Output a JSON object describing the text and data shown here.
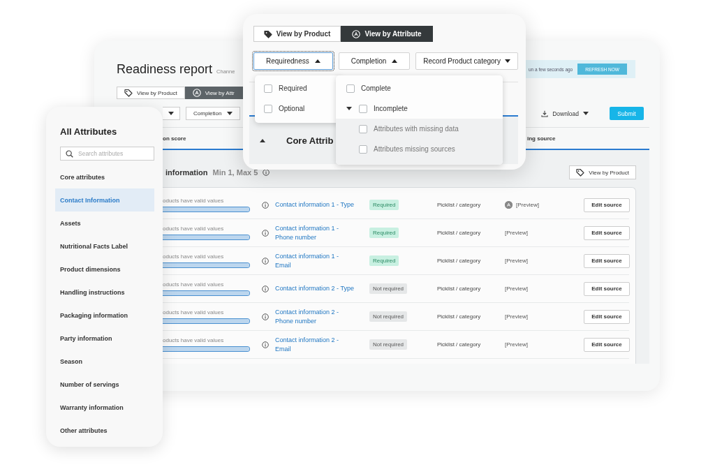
{
  "report": {
    "title": "Readiness report",
    "channel": "Channe",
    "banner": {
      "text": "un a few seconds ago",
      "button": "REFRESH NOW"
    },
    "view_tabs": [
      {
        "label": "View by Product",
        "kind": "tag",
        "selected": false
      },
      {
        "label": "View by Attr",
        "kind": "attribute",
        "selected": true
      }
    ],
    "filters": [
      {
        "expanded": false
      },
      {
        "label": "Completion",
        "expanded": false
      }
    ],
    "download": "Download",
    "submit": "Submit",
    "columns": [
      "on score",
      "ing source"
    ],
    "group": {
      "name": "information",
      "limits": "Min 1, Max 5",
      "button": "View by Product"
    },
    "rows": [
      {
        "summary": "oducts have valid values",
        "level": 1,
        "name": "Contact information 1 - Type",
        "requirement": "Required",
        "required": true,
        "type": "Picklist / category",
        "preview": "[Preview]",
        "has_icon": true,
        "action": "Edit source"
      },
      {
        "summary": "oducts have valid values",
        "level": 1,
        "name": "Contact information 1 - Phone number",
        "requirement": "Required",
        "required": true,
        "type": "Picklist / category",
        "preview": "[Preview]",
        "has_icon": false,
        "action": "Edit source"
      },
      {
        "summary": "oducts have valid values",
        "level": 1,
        "name": "Contact information 1 - Email",
        "requirement": "Required",
        "required": true,
        "type": "Picklist / category",
        "preview": "[Preview]",
        "has_icon": false,
        "action": "Edit source"
      },
      {
        "summary": "oducts have valid values",
        "level": 1,
        "name": "Contact information 2 - Type",
        "requirement": "Not required",
        "required": false,
        "type": "Picklist / category",
        "preview": "[Preview]",
        "has_icon": false,
        "action": "Edit source"
      },
      {
        "summary": "oducts have valid values",
        "level": 1,
        "name": "Contact information 2 - Phone number",
        "requirement": "Not required",
        "required": false,
        "type": "Picklist / category",
        "preview": "[Preview]",
        "has_icon": false,
        "action": "Edit source"
      },
      {
        "summary": "oducts have valid values",
        "level": 1,
        "name": "Contact information 2 - Email",
        "requirement": "Not required",
        "required": false,
        "type": "Picklist / category",
        "preview": "[Preview]",
        "has_icon": false,
        "action": "Edit source"
      }
    ]
  },
  "sidebar": {
    "title": "All Attributes",
    "search": {
      "placeholder": "Search attributes"
    },
    "items": [
      {
        "label": "Core attributes",
        "selected": false
      },
      {
        "label": "Contact Information",
        "selected": true
      },
      {
        "label": "Assets",
        "selected": false
      },
      {
        "label": "Nutritional Facts Label",
        "selected": false
      },
      {
        "label": "Product dimensions",
        "selected": false
      },
      {
        "label": "Handling instructions",
        "selected": false
      },
      {
        "label": "Packaging information",
        "selected": false
      },
      {
        "label": "Party information",
        "selected": false
      },
      {
        "label": "Season",
        "selected": false
      },
      {
        "label": "Number of servings",
        "selected": false
      },
      {
        "label": "Warranty information",
        "selected": false
      },
      {
        "label": "Other attributes",
        "selected": false
      }
    ]
  },
  "popup": {
    "view_tabs": [
      {
        "label": "View by Product",
        "kind": "tag",
        "selected": false
      },
      {
        "label": "View by Attribute",
        "kind": "attribute",
        "selected": true
      }
    ],
    "filters": [
      {
        "label": "Requiredness",
        "expanded": true,
        "focused": true
      },
      {
        "label": "Completion",
        "expanded": true,
        "focused": false
      },
      {
        "label": "Record Product category",
        "expanded": false,
        "focused": false
      }
    ],
    "section": {
      "label": "Core Attrib",
      "expanded": true
    },
    "requiredness_menu": [
      {
        "label": "Required",
        "checked": false
      },
      {
        "label": "Optional",
        "checked": false
      }
    ],
    "completion_menu": [
      {
        "label": "Complete",
        "checked": false
      },
      {
        "label": "Incomplete",
        "checked": false,
        "expanded": true,
        "children": [
          {
            "label": "Attributes with missing data",
            "checked": false
          },
          {
            "label": "Attributes missing sources",
            "checked": false
          }
        ]
      }
    ]
  }
}
